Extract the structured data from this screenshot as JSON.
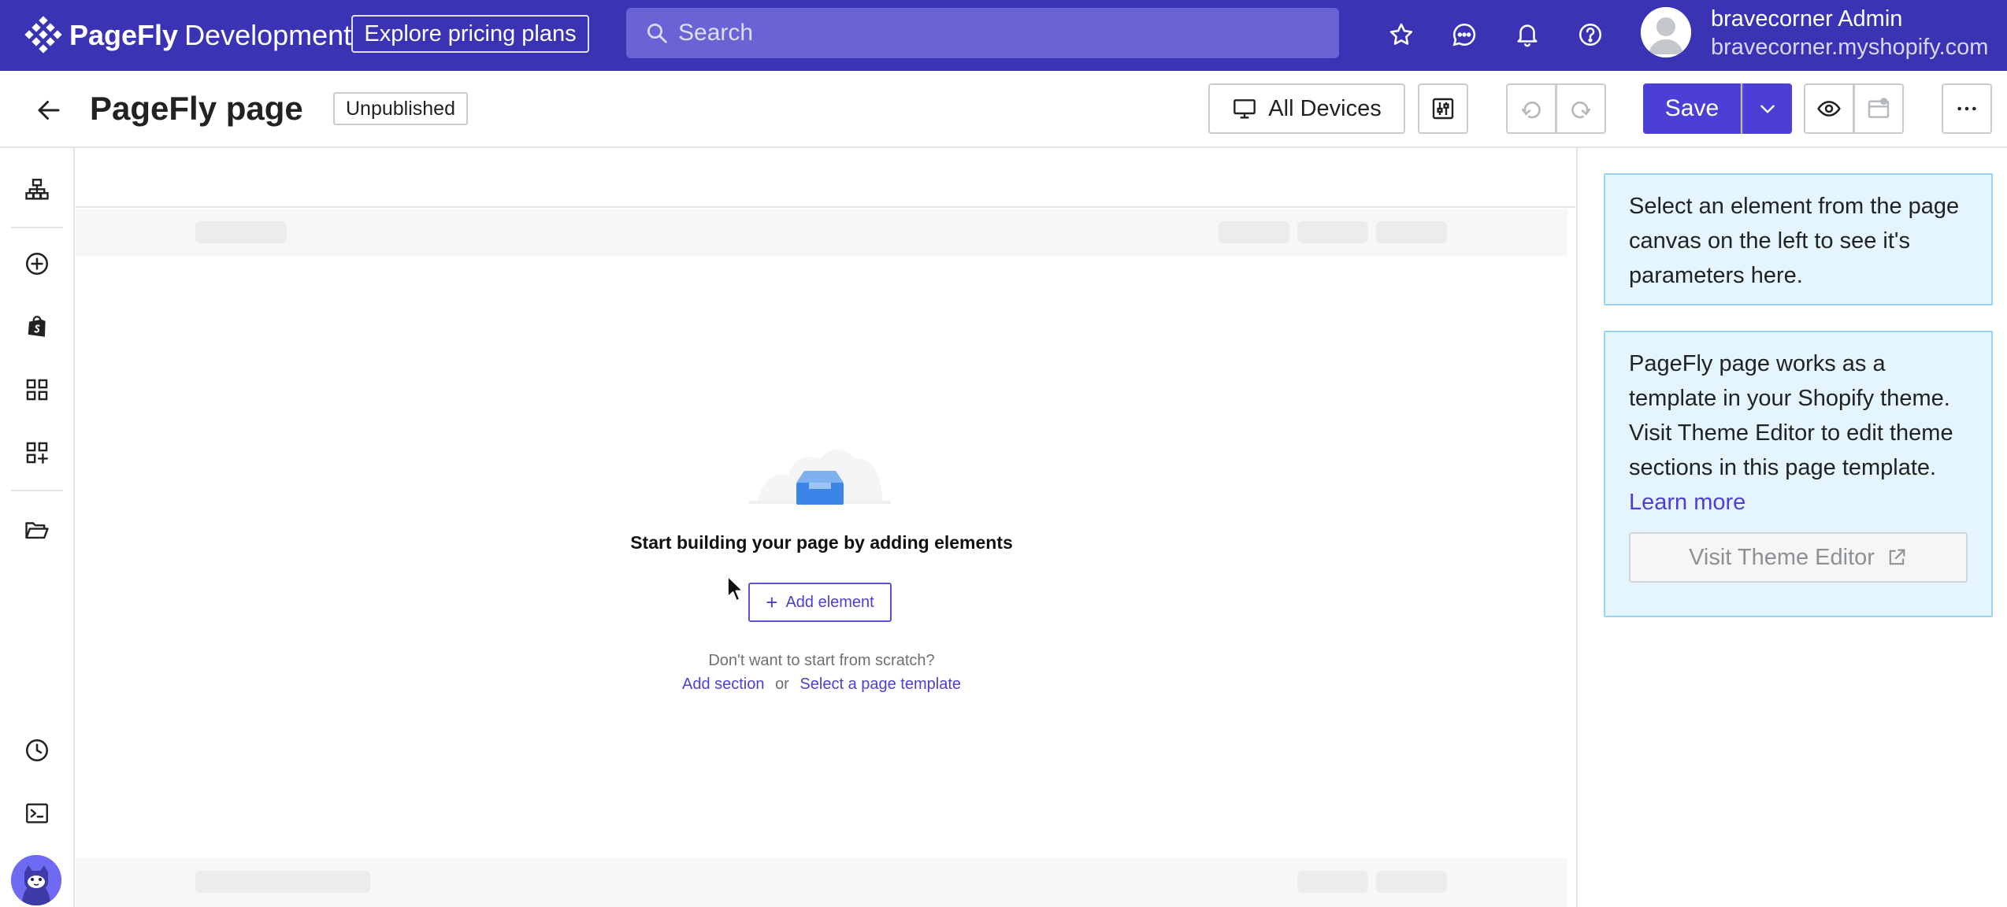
{
  "topbar": {
    "brand_name": "PageFly",
    "brand_env": "Development",
    "pricing_label": "Explore pricing plans",
    "search_placeholder": "Search",
    "user_name": "bravecorner Admin",
    "user_shop": "bravecorner.myshopify.com",
    "icons": [
      "star-icon",
      "chat-icon",
      "bell-icon",
      "help-icon"
    ]
  },
  "header": {
    "title": "PageFly page",
    "status": "Unpublished",
    "devices_label": "All Devices",
    "save_label": "Save"
  },
  "rail": {
    "icons": [
      "layers-icon",
      "add-circle-icon",
      "shopify-bag-icon",
      "grid-icon",
      "add-grid-icon",
      "folder-icon",
      "history-icon",
      "terminal-icon"
    ]
  },
  "canvas": {
    "empty_title": "Start building your page by adding elements",
    "add_element_label": "Add element",
    "scratch_text": "Don't want to start from scratch?",
    "add_section_label": "Add section",
    "or_label": "or",
    "template_label": "Select a page template"
  },
  "panel": {
    "select_hint": "Select an element from the page canvas on the left to see it's parameters here.",
    "theme_info": "PageFly page works as a template in your Shopify theme. Visit Theme Editor to edit theme sections in this page template.",
    "learn_more": "Learn more",
    "visit_theme_label": "Visit Theme Editor"
  },
  "colors": {
    "topbar": "#3a33b3",
    "accent": "#4b3fd6",
    "info_bg": "#e4f5fd",
    "info_border": "#9cd4f2"
  }
}
